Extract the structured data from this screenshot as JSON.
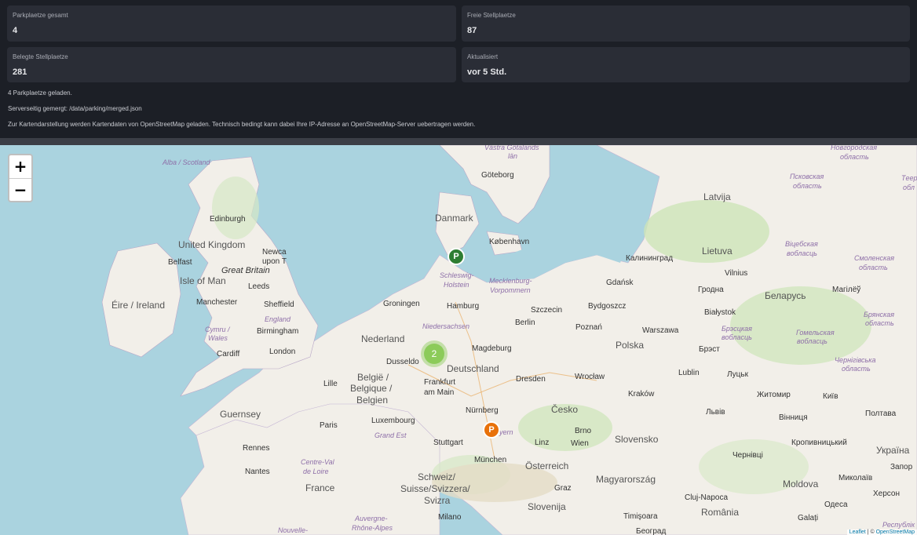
{
  "stats": [
    {
      "label": "Parkplaetze gesamt",
      "value": "4"
    },
    {
      "label": "Freie Stellplaetze",
      "value": "87"
    },
    {
      "label": "Belegte Stellplaetze",
      "value": "281"
    },
    {
      "label": "Aktualisiert",
      "value": "vor 5 Std."
    }
  ],
  "notes": [
    "4 Parkplaetze geladen.",
    "Serverseitig gemergt: /data/parking/merged.json",
    "Zur Kartendarstellung werden Kartendaten von OpenStreetMap geladen. Technisch bedingt kann dabei Ihre IP-Adresse an OpenStreetMap-Server uebertragen werden."
  ],
  "map": {
    "zoom_in": "+",
    "zoom_out": "−",
    "attribution_leaflet": "Leaflet",
    "attribution_sep": " | © ",
    "attribution_osm": "OpenStreetMap",
    "markers": {
      "cluster_count": "2",
      "parking_green": "P",
      "parking_orange": "P"
    },
    "colors": {
      "water": "#aad3df",
      "land": "#f2efe9",
      "marker_green": "#2e7d32",
      "marker_orange": "#e8710a",
      "cluster": "#8ccb5a"
    },
    "labels": {
      "vastra": "Västra Götalands",
      "lan": "län",
      "novgorod": "Новгородская",
      "oblast1": "область",
      "alba": "Alba / Scotland",
      "goteborg": "Göteborg",
      "pskov": "Псковская",
      "oblast2": "область",
      "teer": "Tеер",
      "obl": "обл",
      "latvija": "Latvija",
      "edinburgh": "Edinburgh",
      "danmark": "Danmark",
      "kobenhavn": "København",
      "uk": "United Kingdom",
      "newcastle": "Newca",
      "upon": "upon T",
      "belfast": "Belfast",
      "greatbritain": "Great Britain",
      "isleofman": "Isle of Man",
      "leeds": "Leeds",
      "schleswig": "Schleswig-",
      "holstein": "Holstein",
      "mecklenburg": "Mecklenburg-",
      "vorpommern": "Vorpommern",
      "kaliningrad": "Калининград",
      "lietuva": "Lietuva",
      "vitebsk": "Віцебская",
      "voblasc1": "вобласць",
      "smolensk": "Смоленская",
      "oblast3": "область",
      "vilnius": "Vilnius",
      "gdansk": "Gdańsk",
      "grodno": "Гродна",
      "belarus": "Беларусь",
      "mogilev": "Магілёў",
      "bryansk": "Брянская",
      "oblast4": "область",
      "eire": "Éire / Ireland",
      "manchester": "Manchester",
      "sheffield": "Sheffield",
      "groningen": "Groningen",
      "hamburg": "Hamburg",
      "szczecin": "Szczecin",
      "bydgoszcz": "Bydgoszcz",
      "bialystok": "Białystok",
      "england": "England",
      "cymru": "Cymru /",
      "wales": "Wales",
      "birmingham": "Birmingham",
      "niedersachsen": "Niedersachsen",
      "berlin": "Berlin",
      "poznan": "Poznań",
      "warszawa": "Warszawa",
      "brest_obl": "Брэсцкая",
      "voblasc2": "вобласць",
      "gomel": "Гомельская",
      "voblasc3": "вобласць",
      "nederland": "Nederland",
      "cardiff": "Cardiff",
      "london": "London",
      "magdeburg": "Magdeburg",
      "polska": "Polska",
      "brest": "Брэст",
      "chernihiv": "Чернігівська",
      "oblast5": "область",
      "dusseldorf": "Dusseldo",
      "deutschland": "Deutschland",
      "lublin": "Lublin",
      "lutsk": "Луцьк",
      "belgie": "België /",
      "belgique": "Belgique /",
      "belgien": "Belgien",
      "lille": "Lille",
      "frankfurt": "Frankfurt",
      "ammain": "am Main",
      "dresden": "Dresden",
      "wroclaw": "Wrocław",
      "zhytomyr": "Житомир",
      "kyiv": "Київ",
      "krakow": "Kraków",
      "guernsey": "Guernsey",
      "luxembourg": "Luxembourg",
      "nurnberg": "Nürnberg",
      "cesko": "Česko",
      "lviv": "Львів",
      "vinnytsia": "Вінниця",
      "poltava": "Полтава",
      "paris": "Paris",
      "grandest": "Grand Est",
      "bayern": "yern",
      "brno": "Brno",
      "stuttgart": "Stuttgart",
      "linz": "Linz",
      "wien": "Wien",
      "slovensko": "Slovensko",
      "kropyvnytskyi": "Кропивницький",
      "ukraina": "Україна",
      "rennes": "Rennes",
      "centre": "Centre-Val",
      "deloire": "de Loire",
      "munchen": "München",
      "osterreich": "Österreich",
      "chernivtsi": "Чернівці",
      "zapor": "Запор",
      "nantes": "Nantes",
      "schweiz": "Schweiz/",
      "suisse": "Suisse/Svizzera/",
      "svizra": "Svizra",
      "magyarorszag": "Magyarország",
      "mykolaiv": "Миколаїв",
      "kherson": "Херсон",
      "france": "France",
      "graz": "Graz",
      "moldova": "Moldova",
      "clujnapoca": "Cluj-Napoca",
      "odesa": "Одеса",
      "slovenija": "Slovenija",
      "romania": "România",
      "milano": "Milano",
      "auvergne": "Auvergne-",
      "rhonealpes": "Rhône-Alpes",
      "nouvelle": "Nouvelle-",
      "timisoara": "Timişoara",
      "galati": "Galați",
      "respublik": "Республік",
      "beograd": "Београд"
    }
  }
}
